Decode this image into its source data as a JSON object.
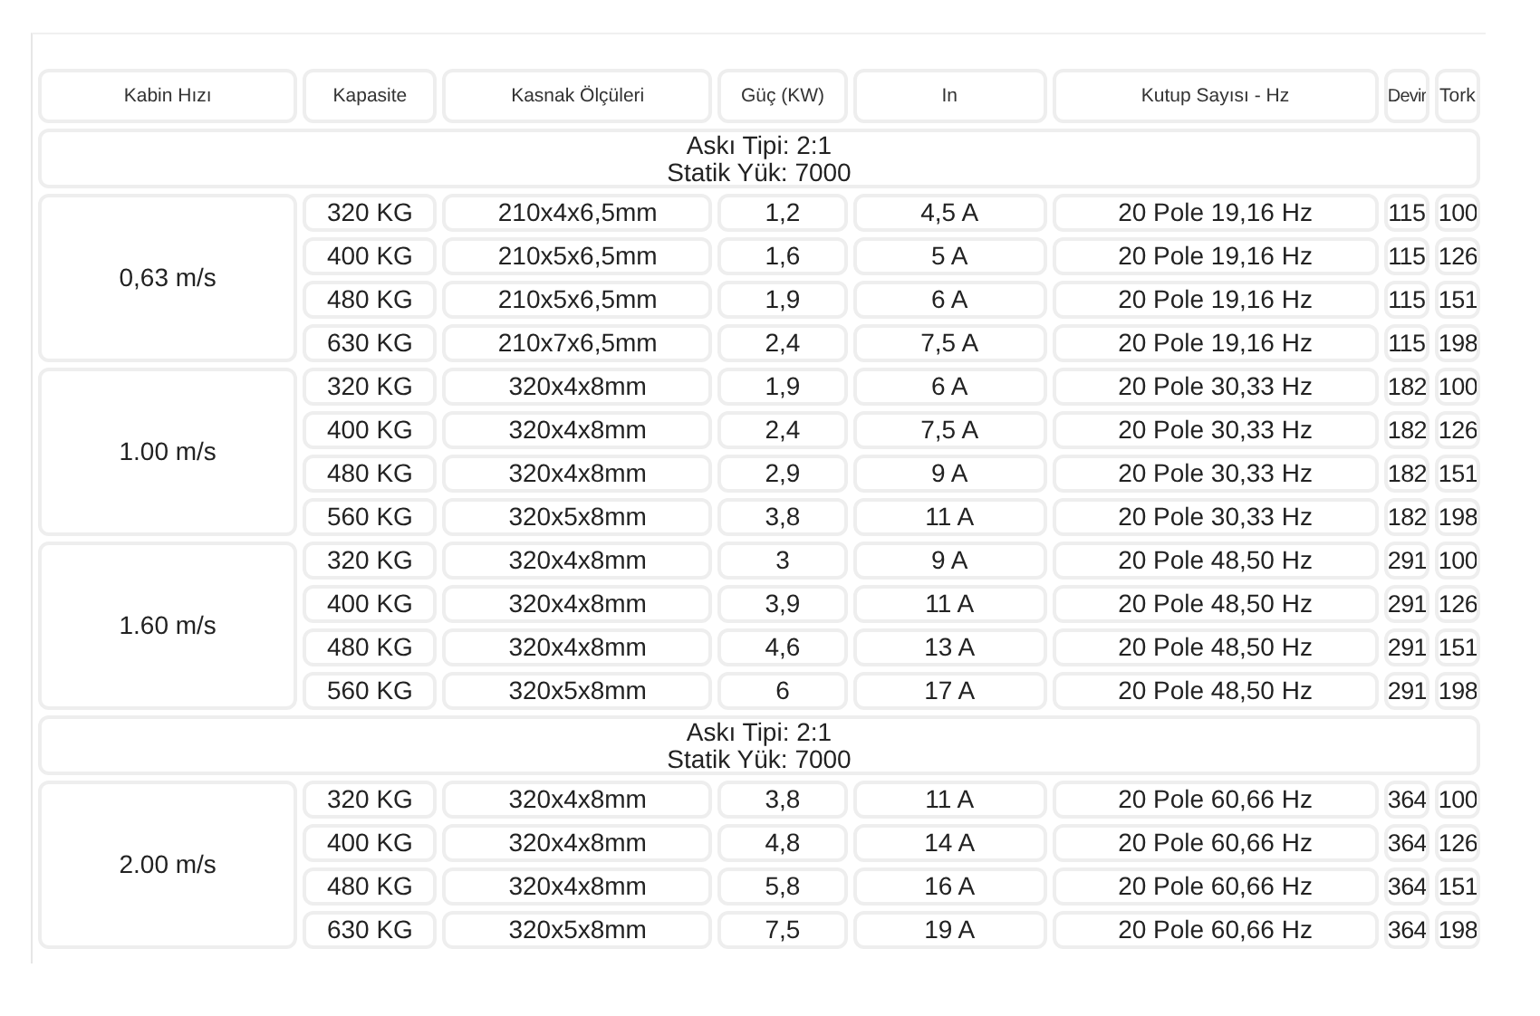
{
  "table": {
    "columns": [
      "Kabin Hızı",
      "Kapasite",
      "Kasnak Ölçüleri",
      "Güç (KW)",
      "In",
      "Kutup Sayısı - Hz",
      "Devir",
      "Tork"
    ],
    "body": [
      {
        "kind": "note",
        "lines": [
          "Askı Tipi: 2:1",
          "Statik Yük: 7000"
        ]
      },
      {
        "kind": "speed",
        "speed": "0,63 m/s",
        "rows": [
          [
            "320 KG",
            "210x4x6,5mm",
            "1,2",
            "4,5 A",
            "20 Pole 19,16 Hz",
            "115",
            "100"
          ],
          [
            "400 KG",
            "210x5x6,5mm",
            "1,6",
            "5 A",
            "20 Pole 19,16 Hz",
            "115",
            "126"
          ],
          [
            "480 KG",
            "210x5x6,5mm",
            "1,9",
            "6 A",
            "20 Pole 19,16 Hz",
            "115",
            "151"
          ],
          [
            "630 KG",
            "210x7x6,5mm",
            "2,4",
            "7,5 A",
            "20 Pole 19,16 Hz",
            "115",
            "198"
          ]
        ]
      },
      {
        "kind": "speed",
        "speed": "1.00 m/s",
        "rows": [
          [
            "320 KG",
            "320x4x8mm",
            "1,9",
            "6 A",
            "20 Pole 30,33 Hz",
            "182",
            "100"
          ],
          [
            "400 KG",
            "320x4x8mm",
            "2,4",
            "7,5 A",
            "20 Pole 30,33 Hz",
            "182",
            "126"
          ],
          [
            "480 KG",
            "320x4x8mm",
            "2,9",
            "9 A",
            "20 Pole 30,33 Hz",
            "182",
            "151"
          ],
          [
            "560 KG",
            "320x5x8mm",
            "3,8",
            "11 A",
            "20 Pole 30,33 Hz",
            "182",
            "198"
          ]
        ]
      },
      {
        "kind": "speed",
        "speed": "1.60 m/s",
        "rows": [
          [
            "320 KG",
            "320x4x8mm",
            "3",
            "9 A",
            "20 Pole 48,50 Hz",
            "291",
            "100"
          ],
          [
            "400 KG",
            "320x4x8mm",
            "3,9",
            "11 A",
            "20 Pole 48,50 Hz",
            "291",
            "126"
          ],
          [
            "480 KG",
            "320x4x8mm",
            "4,6",
            "13 A",
            "20 Pole 48,50 Hz",
            "291",
            "151"
          ],
          [
            "560 KG",
            "320x5x8mm",
            "6",
            "17 A",
            "20 Pole 48,50 Hz",
            "291",
            "198"
          ]
        ]
      },
      {
        "kind": "note",
        "lines": [
          "Askı Tipi: 2:1",
          "Statik Yük: 7000"
        ]
      },
      {
        "kind": "speed",
        "speed": "2.00 m/s",
        "rows": [
          [
            "320 KG",
            "320x4x8mm",
            "3,8",
            "11 A",
            "20 Pole 60,66 Hz",
            "364",
            "100"
          ],
          [
            "400 KG",
            "320x4x8mm",
            "4,8",
            "14 A",
            "20 Pole 60,66 Hz",
            "364",
            "126"
          ],
          [
            "480 KG",
            "320x4x8mm",
            "5,8",
            "16 A",
            "20 Pole 60,66 Hz",
            "364",
            "151"
          ],
          [
            "630 KG",
            "320x5x8mm",
            "7,5",
            "19 A",
            "20 Pole 60,66 Hz",
            "364",
            "198"
          ]
        ]
      }
    ]
  }
}
